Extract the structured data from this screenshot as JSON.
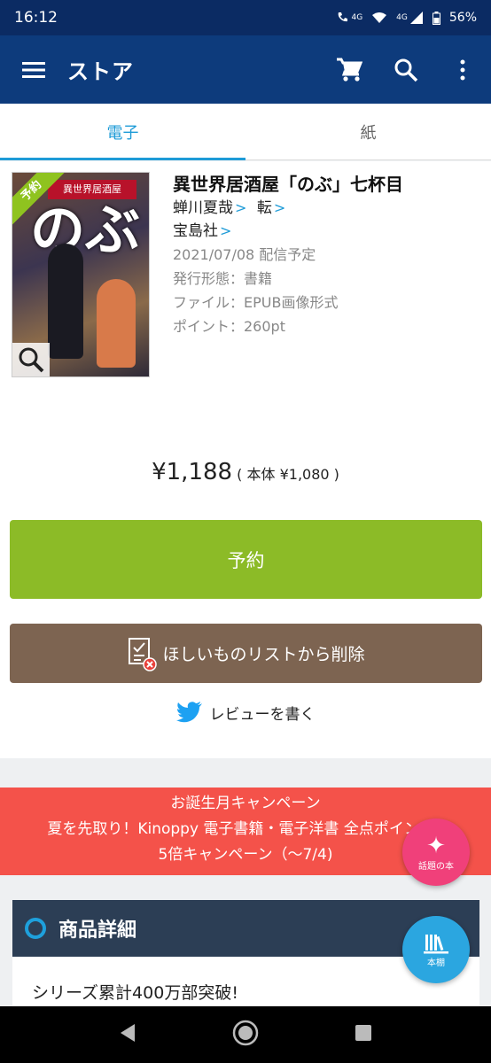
{
  "status_bar": {
    "time": "16:12",
    "call_label": "4G",
    "network_label": "4G",
    "battery": "56%"
  },
  "app_bar": {
    "title": "ストア",
    "icons": [
      "menu-icon",
      "cart-icon",
      "search-icon",
      "more-vert-icon"
    ]
  },
  "tabs": [
    {
      "label": "電子",
      "active": true
    },
    {
      "label": "紙",
      "active": false
    }
  ],
  "cover": {
    "ribbon": "予約",
    "big_text": "のぶ",
    "label": "異世界居酒屋"
  },
  "book": {
    "title": "異世界居酒屋「のぶ」七杯目",
    "author": "蝉川夏哉",
    "illustrator": "転",
    "publisher": "宝島社",
    "release": "2021/07/08 配信予定",
    "format": "発行形態：書籍",
    "file": "ファイル：EPUB画像形式",
    "points": "ポイント：260pt"
  },
  "price": {
    "main": "¥1,188",
    "sub": "( 本体 ¥1,080 )"
  },
  "buttons": {
    "reserve": "予約",
    "wishlist_remove": "ほしいものリストから削除",
    "review": "レビューを書く"
  },
  "campaign": {
    "line1": "お誕生月キャンペーン",
    "line2": "夏を先取り！Kinoppy 電子書籍・電子洋書 全点ポイント2",
    "line3": "5倍キャンペーン（〜7/4)"
  },
  "details": {
    "heading": "商品詳細",
    "text": "シリーズ累計400万部突破!"
  },
  "fabs": {
    "topics_label": "話題の本",
    "shelf_label": "本棚"
  },
  "colors": {
    "app_bar": "#0d3b7c",
    "status_bar": "#0b2b63",
    "tab_active": "#1e9bd7",
    "reserve_button": "#8cbb27",
    "wishlist_button": "#7d6451",
    "campaign": "#f4524a",
    "details_header": "#2c3e55",
    "fab_pink": "#f0407a",
    "fab_blue": "#2ba6e0"
  }
}
